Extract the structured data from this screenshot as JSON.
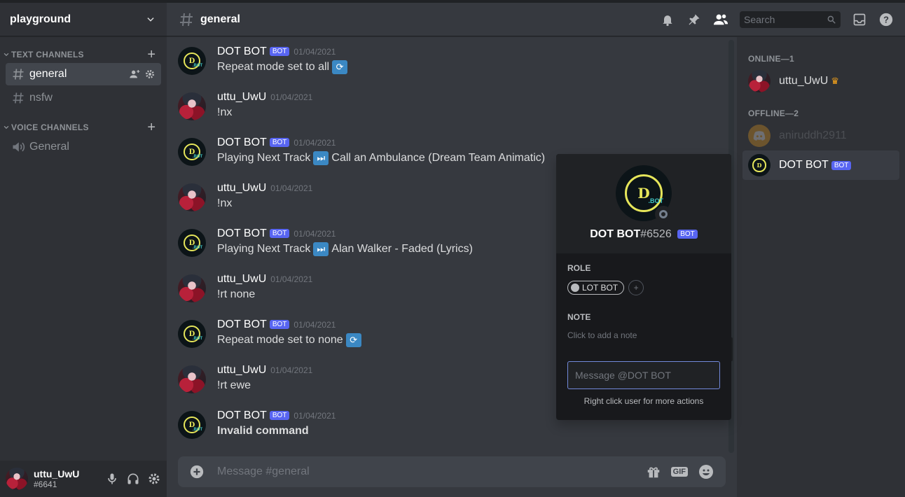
{
  "server": {
    "name": "playground"
  },
  "sidebar": {
    "text_category": "TEXT CHANNELS",
    "voice_category": "VOICE CHANNELS",
    "text_channels": [
      {
        "label": "general",
        "active": true
      },
      {
        "label": "nsfw",
        "active": false
      }
    ],
    "voice_channels": [
      {
        "label": "General"
      }
    ]
  },
  "user_panel": {
    "username": "uttu_UwU",
    "tag": "#6641"
  },
  "header": {
    "channel": "general",
    "search_placeholder": "Search"
  },
  "messages": [
    {
      "author": "DOT BOT",
      "bot": true,
      "bot_tag": "BOT",
      "timestamp": "01/04/2021",
      "text": "Repeat mode set to all",
      "emoji": "repeat-icon"
    },
    {
      "author": "uttu_UwU",
      "bot": false,
      "timestamp": "01/04/2021",
      "text": "!nx"
    },
    {
      "author": "DOT BOT",
      "bot": true,
      "bot_tag": "BOT",
      "timestamp": "01/04/2021",
      "text": "Call an Ambulance (Dream Team Animatic)",
      "prefix": "Playing Next Track",
      "emoji": "next-track-icon"
    },
    {
      "author": "uttu_UwU",
      "bot": false,
      "timestamp": "01/04/2021",
      "text": "!nx"
    },
    {
      "author": "DOT BOT",
      "bot": true,
      "bot_tag": "BOT",
      "timestamp": "01/04/2021",
      "text": "Alan Walker - Faded (Lyrics)",
      "prefix": "Playing Next Track",
      "emoji": "next-track-icon"
    },
    {
      "author": "uttu_UwU",
      "bot": false,
      "timestamp": "01/04/2021",
      "text": "!rt none"
    },
    {
      "author": "DOT BOT",
      "bot": true,
      "bot_tag": "BOT",
      "timestamp": "01/04/2021",
      "text": "Repeat mode set to none",
      "emoji": "repeat-icon"
    },
    {
      "author": "uttu_UwU",
      "bot": false,
      "timestamp": "01/04/2021",
      "text": "!rt ewe"
    },
    {
      "author": "DOT BOT",
      "bot": true,
      "bot_tag": "BOT",
      "timestamp": "01/04/2021",
      "text": "Invalid command",
      "bold": true
    }
  ],
  "composer": {
    "placeholder": "Message #general",
    "gif_label": "GIF"
  },
  "members": {
    "online_label": "ONLINE—1",
    "offline_label": "OFFLINE—2",
    "online": [
      {
        "name": "uttu_UwU"
      }
    ],
    "offline": [
      {
        "name": "aniruddh2911"
      },
      {
        "name": "DOT BOT",
        "bot_tag": "BOT"
      }
    ]
  },
  "popout": {
    "name": "DOT BOT",
    "discriminator": "#6526",
    "bot_tag": "BOT",
    "role_label": "ROLE",
    "role": "LOT BOT",
    "role_add": "+",
    "note_label": "NOTE",
    "note_hint": "Click to add a note",
    "message_placeholder": "Message @DOT BOT",
    "hint": "Right click user for more actions",
    "avatar_text": "D",
    "avatar_subtext": ".BOT"
  }
}
